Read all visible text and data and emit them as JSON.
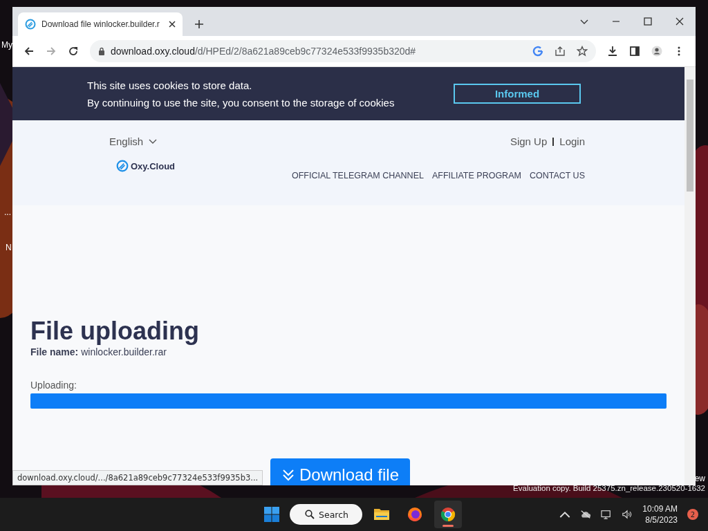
{
  "desktop": {
    "labels": [
      "My",
      "...",
      "N",
      "ew"
    ],
    "watermark": "Evaluation copy. Build 25375.zn_release.230520-1632"
  },
  "browser": {
    "tab": {
      "title": "Download file winlocker.builder.r",
      "selected": true
    },
    "url": {
      "host": "download.oxy.cloud",
      "path": "/d/HPEd/2/8a621a89ceb9c77324e533f9935b320d#"
    },
    "status_link": "download.oxy.cloud/.../8a621a89ceb9c77324e533f9935b3..."
  },
  "cookie_banner": {
    "lines": [
      "This site uses cookies to store data.",
      "By continuing to use the site, you consent to the storage of cookies"
    ],
    "button": "Informed"
  },
  "header": {
    "language": "English",
    "auth": [
      "Sign Up",
      "Login"
    ],
    "logo": "Oxy.Cloud",
    "nav": [
      "OFFICIAL TELEGRAM CHANNEL",
      "AFFILIATE PROGRAM",
      "CONTACT US"
    ]
  },
  "upload": {
    "title": "File uploading",
    "file_label": "File name:",
    "file_name": "winlocker.builder.rar",
    "progress_label": "Uploading:",
    "level": 1,
    "button": "Download file"
  },
  "taskbar": {
    "search": "Search",
    "apps": [
      {
        "kind": "files",
        "selected": false
      },
      {
        "kind": "firefox",
        "selected": false
      },
      {
        "kind": "chrome",
        "selected": true
      }
    ],
    "time": "10:09 AM",
    "date": "8/5/2023",
    "notifications": "2"
  }
}
